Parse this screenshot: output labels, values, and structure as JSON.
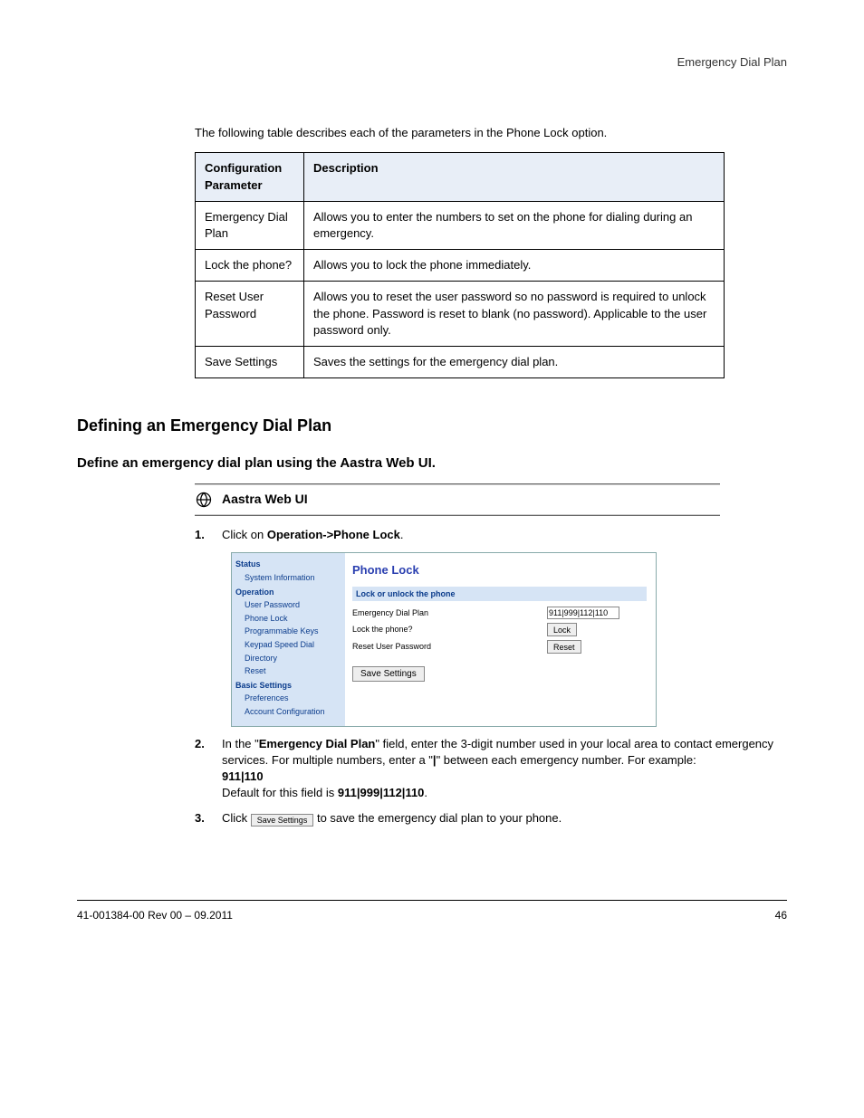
{
  "top_label": "Emergency Dial Plan",
  "intro": "The following table describes each of the parameters in the Phone Lock option.",
  "params_table": {
    "headers": [
      "Configuration Parameter",
      "Description"
    ],
    "rows": [
      [
        "Emergency Dial Plan",
        "Allows you to enter the numbers to set on the phone for dialing during an emergency."
      ],
      [
        "Lock the phone?",
        "Allows you to lock the phone immediately."
      ],
      [
        "Reset User Password",
        "Allows you to reset the user password so no password is required to unlock the phone. Password is reset to blank (no password). Applicable to the user password only."
      ],
      [
        "Save Settings",
        "Saves the settings for the emergency dial plan."
      ]
    ]
  },
  "section_title": "Defining an Emergency Dial Plan",
  "sub_title": "Define an emergency dial plan using the Aastra Web UI.",
  "webui_banner": "Aastra Web UI",
  "step1_lead": "1.",
  "step1_text_a": "Click on ",
  "step1_text_b": "Operation->Phone Lock",
  "step1_text_c": ".",
  "screenshot": {
    "sidebar": {
      "groups": [
        {
          "label": "Status",
          "items": [
            "System Information"
          ]
        },
        {
          "label": "Operation",
          "items": [
            "User Password",
            "Phone Lock",
            "Programmable Keys",
            "Keypad Speed Dial",
            "Directory",
            "Reset"
          ]
        },
        {
          "label": "Basic Settings",
          "items": [
            "Preferences",
            "Account Configuration"
          ]
        }
      ]
    },
    "main": {
      "title": "Phone Lock",
      "bar": "Lock or unlock the phone",
      "rows": [
        {
          "label": "Emergency Dial Plan",
          "ctl": "text",
          "value": "911|999|112|110"
        },
        {
          "label": "Lock the phone?",
          "ctl": "button",
          "value": "Lock"
        },
        {
          "label": "Reset User Password",
          "ctl": "button",
          "value": "Reset"
        }
      ],
      "save": "Save Settings"
    }
  },
  "step2_lead": "2.",
  "step2_a": "In the \"",
  "step2_b": "Emergency Dial Plan",
  "step2_c": "\" field, enter the 3-digit number used in your local area to contact emergency services. For multiple numbers, enter a \"",
  "step2_d": "|",
  "step2_e": "\" between each emergency number. For example:",
  "step2_example": "911|110",
  "step2_note": "Default for this field is ",
  "step2_note_b": "911|999|112|110",
  "step2_note_c": ".",
  "step3_lead": "3.",
  "step3_a": "Click ",
  "step3_btn": "Save Settings",
  "step3_b": " to save the emergency dial plan to your phone.",
  "footer": {
    "left": "41-001384-00 Rev 00 – 09.2011",
    "right": "46"
  }
}
